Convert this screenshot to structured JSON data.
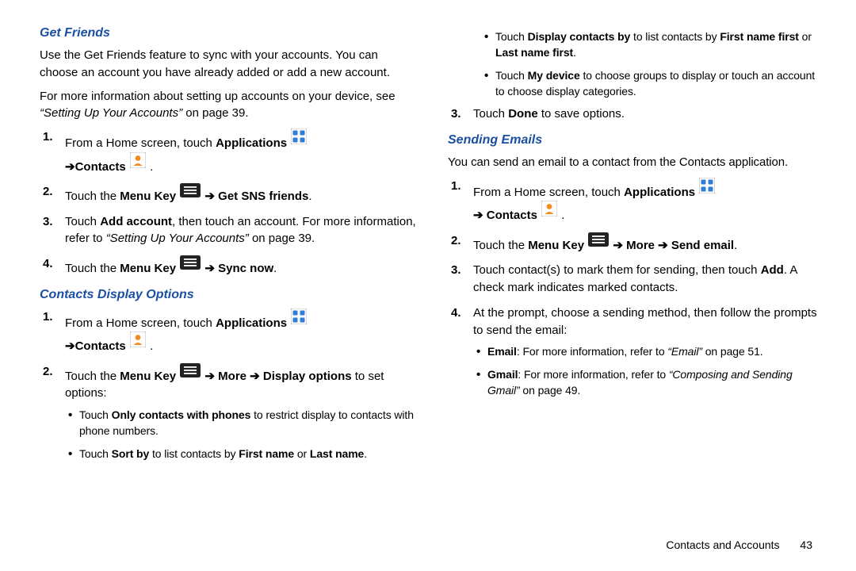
{
  "left": {
    "getFriends": {
      "title": "Get Friends",
      "intro": "Use the Get Friends feature to sync with your accounts. You can choose an account you have already added or add a new account.",
      "moreInfo_pre": "For more information about setting up accounts on your device, see ",
      "moreInfo_ref": "“Setting Up Your Accounts”",
      "moreInfo_post": " on page 39.",
      "steps": {
        "s1_a": "From a Home screen, touch ",
        "s1_apps": "Applications",
        "s1_b": " ",
        "s1_ar1": "➔",
        "s1_contacts": "Contacts",
        "s1_c": " .",
        "s2_a": "Touch the ",
        "s2_menu": "Menu Key",
        "s2_ar": " ➔ ",
        "s2_get": "Get SNS friends",
        "s2_c": ".",
        "s3_a": "Touch ",
        "s3_add": "Add account",
        "s3_b": ", then touch an account. For more information, refer to ",
        "s3_ref": "“Setting Up Your Accounts” ",
        "s3_c": " on page 39.",
        "s4_a": "Touch the ",
        "s4_menu": "Menu Key",
        "s4_ar": " ➔ ",
        "s4_sync": "Sync now",
        "s4_c": "."
      }
    },
    "displayOptions": {
      "title": "Contacts Display Options",
      "steps": {
        "s1_a": "From a Home screen, touch ",
        "s1_apps": "Applications",
        "s1_ar1": "➔",
        "s1_contacts": "Contacts",
        "s1_c": " .",
        "s2_a": "Touch the ",
        "s2_menu": "Menu Key",
        "s2_ar1": " ➔ ",
        "s2_more": "More",
        "s2_ar2": " ➔ ",
        "s2_disp": "Display options",
        "s2_b": " to set options:"
      },
      "bullets": {
        "b1_a": "Touch ",
        "b1_only": "Only contacts with phones",
        "b1_b": " to restrict display to contacts with phone numbers.",
        "b2_a": "Touch ",
        "b2_sort": "Sort by",
        "b2_b": " to list contacts by ",
        "b2_fn": "First name",
        "b2_c": " or ",
        "b2_ln": "Last name",
        "b2_d": "."
      }
    }
  },
  "right": {
    "topBullets": {
      "b1_a": "Touch ",
      "b1_disp": "Display contacts by",
      "b1_b": " to list contacts by ",
      "b1_fnf": "First name first",
      "b1_c": " or ",
      "b1_lnf": "Last name first",
      "b1_d": ".",
      "b2_a": "Touch ",
      "b2_my": "My device",
      "b2_b": " to choose groups to display or touch an account to choose display categories."
    },
    "step3_a": "Touch ",
    "step3_done": "Done",
    "step3_b": " to save options.",
    "sendingEmails": {
      "title": "Sending Emails",
      "intro": "You can send an email to a contact from the Contacts application.",
      "steps": {
        "s1_a": "From a Home screen, touch ",
        "s1_apps": "Applications",
        "s1_ar1": "➔ ",
        "s1_contacts": "Contacts",
        "s1_c": " .",
        "s2_a": "Touch the ",
        "s2_menu": "Menu Key",
        "s2_ar1": " ➔ ",
        "s2_more": "More",
        "s2_ar2": " ➔ ",
        "s2_send": "Send email",
        "s2_c": ".",
        "s3_a": "Touch contact(s) to mark them for sending, then touch ",
        "s3_add": "Add",
        "s3_b": ". A check mark indicates marked contacts.",
        "s4": "At the prompt, choose a sending method, then follow the prompts to send the email:"
      },
      "subBullets": {
        "e_a": "Email",
        "e_b": ": For more information, refer to ",
        "e_ref": "“Email” ",
        "e_c": " on page 51.",
        "g_a": "Gmail",
        "g_b": ": For more information, refer to ",
        "g_ref": "“Composing and Sending Gmail” ",
        "g_c": " on page 49."
      }
    }
  },
  "footer": {
    "section": "Contacts and Accounts",
    "page": "43"
  }
}
